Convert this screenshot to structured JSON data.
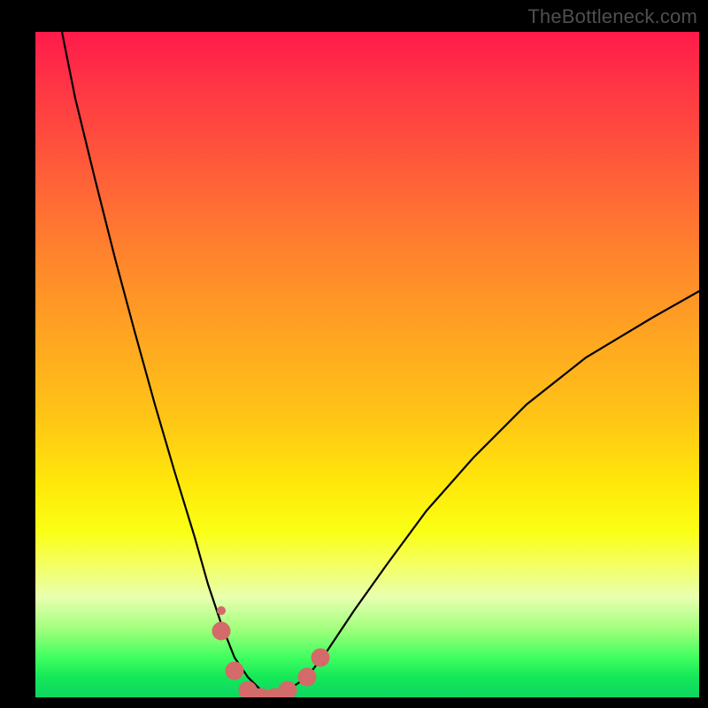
{
  "watermark": {
    "text": "TheBottleneck.com"
  },
  "chart_data": {
    "type": "line",
    "title": "",
    "xlabel": "",
    "ylabel": "",
    "xlim": [
      0,
      100
    ],
    "ylim": [
      0,
      100
    ],
    "grid": false,
    "legend": false,
    "background_gradient": {
      "direction": "vertical",
      "stops": [
        {
          "pos": 0.0,
          "color": "#ff1a4b"
        },
        {
          "pos": 0.45,
          "color": "#ffa322"
        },
        {
          "pos": 0.75,
          "color": "#faff14"
        },
        {
          "pos": 1.0,
          "color": "#0fd662"
        }
      ]
    },
    "series": [
      {
        "name": "bottleneck-curve",
        "color": "#000000",
        "stroke_width": 2,
        "x": [
          4,
          6,
          9,
          12,
          15,
          18,
          21,
          24,
          26,
          28,
          30,
          32,
          34,
          36,
          38,
          41,
          44,
          48,
          53,
          59,
          66,
          74,
          83,
          93,
          100
        ],
        "values": [
          100,
          90,
          78,
          66,
          55,
          44,
          34,
          24,
          17,
          11,
          6,
          3,
          1,
          0,
          1,
          3,
          7,
          13,
          20,
          28,
          36,
          44,
          51,
          57,
          61
        ]
      },
      {
        "name": "bottom-marker-dots",
        "color": "#d46a6a",
        "marker_radius": 8,
        "x": [
          28,
          30,
          32,
          34,
          36,
          38,
          41,
          43
        ],
        "values": [
          10,
          4,
          1,
          0,
          0,
          1,
          3,
          6
        ]
      }
    ],
    "annotations": [
      {
        "name": "small-dot",
        "x": 28,
        "y": 13,
        "color": "#d46a6a",
        "radius": 4
      }
    ]
  }
}
